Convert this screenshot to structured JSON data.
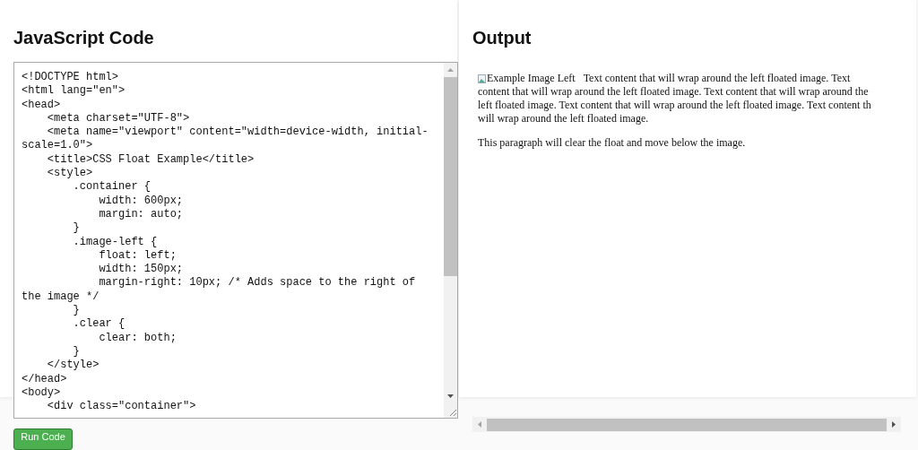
{
  "code_panel": {
    "title": "JavaScript Code",
    "code_lines": [
      "<!DOCTYPE html>",
      "<html lang=\"en\">",
      "<head>",
      "    <meta charset=\"UTF-8\">",
      "    <meta name=\"viewport\" content=\"width=device-width, initial-",
      "scale=1.0\">",
      "    <title>CSS Float Example</title>",
      "    <style>",
      "        .container {",
      "            width: 600px;",
      "            margin: auto;",
      "        }",
      "        .image-left {",
      "            float: left;",
      "            width: 150px;",
      "            margin-right: 10px; /* Adds space to the right of",
      "the image */",
      "        }",
      "        .clear {",
      "            clear: both;",
      "        }",
      "    </style>",
      "</head>",
      "<body>",
      "    <div class=\"container\">"
    ],
    "run_button": "Run Code"
  },
  "output_panel": {
    "title": "Output",
    "image_alt": "Example Image Left",
    "paragraph_lines": [
      "Text content that will wrap around the left floated image. Text",
      "content that will wrap around the left floated image. Text content that will wrap around the",
      "left floated image. Text content that will wrap around the left floated image. Text content th",
      "will wrap around the left floated image."
    ],
    "clear_paragraph": "This paragraph will clear the float and move below the image."
  }
}
